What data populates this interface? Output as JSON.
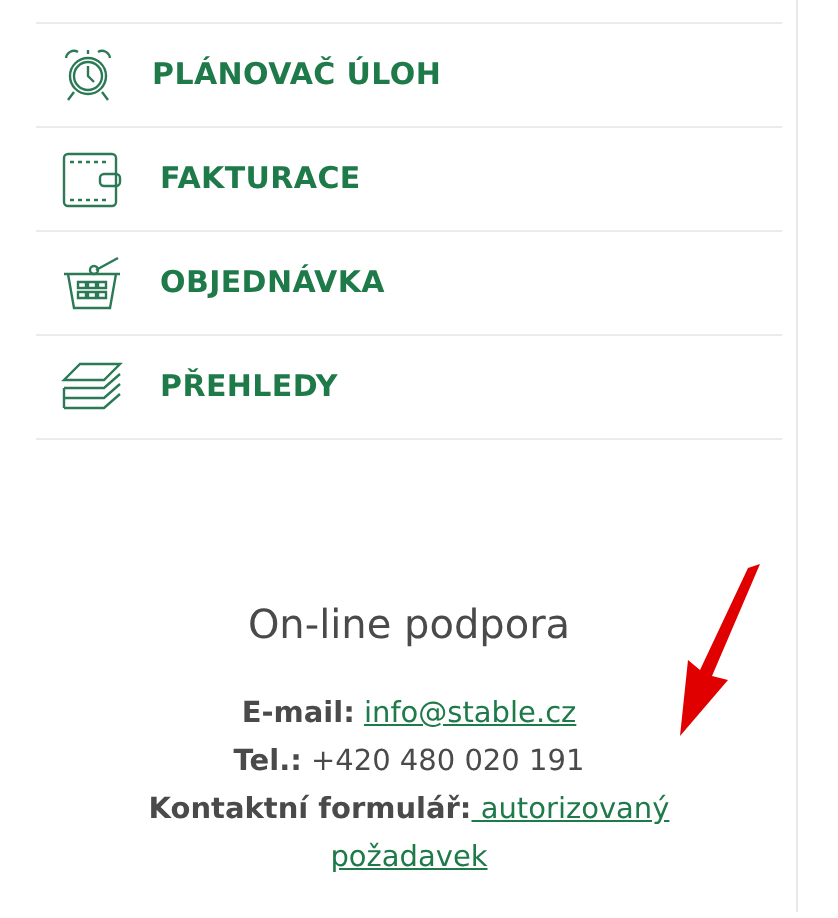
{
  "menu": [
    {
      "label": "PLÁNOVAČ ÚLOH",
      "kind": "alarm"
    },
    {
      "label": "FAKTURACE",
      "kind": "wallet"
    },
    {
      "label": "OBJEDNÁVKA",
      "kind": "basket"
    },
    {
      "label": "PŘEHLEDY",
      "kind": "layers"
    }
  ],
  "support": {
    "title": "On-line podpora",
    "email": {
      "label": "E-mail:",
      "link": "info@stable.cz"
    },
    "phone": {
      "label": "Tel.:",
      "value": "+420 480 020 191"
    },
    "form": {
      "label": "Kontaktní formulář:",
      "link_line_1": " autorizovaný",
      "link_line_2": "požadavek"
    }
  }
}
